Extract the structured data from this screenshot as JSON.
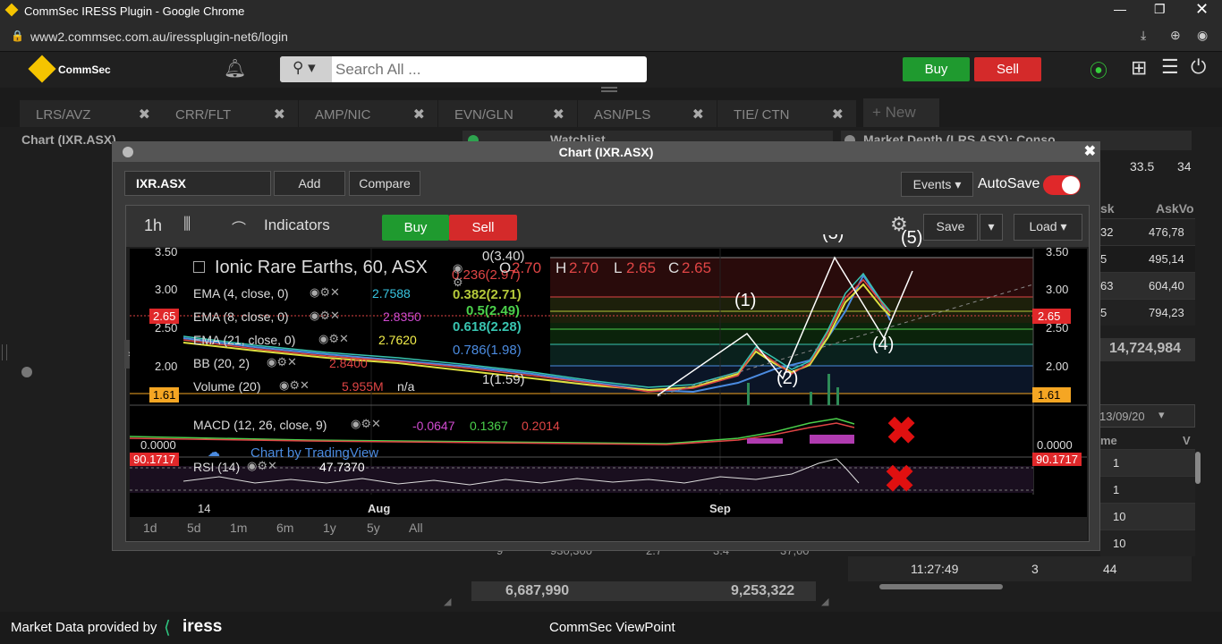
{
  "window": {
    "title": "CommSec IRESS Plugin - Google Chrome",
    "url": "www2.commsec.com.au/iressplugin-net6/login"
  },
  "app": {
    "logo": "CommSec",
    "search_placeholder": "Search All ...",
    "buy": "Buy",
    "sell": "Sell"
  },
  "tabs": [
    {
      "label": "LRS/AVZ"
    },
    {
      "label": "CRR/FLT"
    },
    {
      "label": "AMP/NIC"
    },
    {
      "label": "EVN/GLN"
    },
    {
      "label": "ASN/PLS"
    },
    {
      "label": "TIE/ CTN"
    }
  ],
  "new_tab": "+ New",
  "panels": {
    "left": "Chart (IXR.ASX)",
    "watchlist": "Watchlist",
    "depth": "Market Depth (LRS.ASX): Conso"
  },
  "depth": {
    "top_vals": [
      "33.5",
      "34"
    ],
    "header_k": "sk",
    "header_askv": "AskVo",
    "rows": [
      {
        "a": "32",
        "b": "476,78"
      },
      {
        "a": "5",
        "b": "495,14"
      },
      {
        "a": "63",
        "b": "604,40"
      },
      {
        "a": "5",
        "b": "794,23"
      }
    ],
    "total": "14,724,984",
    "date": "13/09/20",
    "col_me": "me",
    "col_v": "V",
    "trade_rows": [
      "1",
      "1",
      "10",
      "10"
    ],
    "last_time": "11:27:49",
    "last_a": "3",
    "last_b": "44"
  },
  "watchlist_bottom": {
    "row": [
      "9",
      "930,300",
      "2.7",
      "3.4",
      "37,00"
    ],
    "totals": [
      "6,687,990",
      "9,253,322"
    ]
  },
  "modal": {
    "title": "Chart (IXR.ASX)",
    "symbol": "IXR.ASX",
    "add": "Add",
    "compare": "Compare",
    "events": "Events",
    "autosave": "AutoSave"
  },
  "chart_toolbar": {
    "interval": "1h",
    "indicators": "Indicators",
    "buy": "Buy",
    "sell": "Sell",
    "save": "Save",
    "load": "Load"
  },
  "legend": {
    "title": "Ionic Rare Earths, 60, ASX",
    "o_label": "O",
    "o": "2.70",
    "h_label": "H",
    "h": "2.70",
    "l_label": "L",
    "l": "2.65",
    "c_label": "C",
    "c": "2.65",
    "ema4": "EMA (4, close, 0)",
    "ema4_val": "2.7588",
    "ema8": "EMA (8, close, 0)",
    "ema8_val": "2.8350",
    "ema21": "EMA (21, close, 0)",
    "ema21_val": "2.7620",
    "bb": "BB (20, 2)",
    "bb_val": "2.8400",
    "vol": "Volume (20)",
    "vol_val": "5.955M",
    "vol_na": "n/a",
    "macd": "MACD (12, 26, close, 9)",
    "macd_v1": "-0.0647",
    "macd_v2": "0.1367",
    "macd_v3": "0.2014",
    "rsi": "RSI (14)",
    "rsi_val": "47.7370",
    "watermark": "Chart by TradingView"
  },
  "fib": [
    {
      "label": "0(3.40)",
      "color": "#bbbbbb"
    },
    {
      "label": "0.236(2.97)",
      "color": "#e04545"
    },
    {
      "label": "0.382(2.71)",
      "color": "#b5c93a"
    },
    {
      "label": "0.5(2.49)",
      "color": "#4bd04b"
    },
    {
      "label": "0.618(2.28)",
      "color": "#38c4b0"
    },
    {
      "label": "0.786(1.98)",
      "color": "#4b8be0"
    },
    {
      "label": "1(1.59)",
      "color": "#bbbbbb"
    }
  ],
  "waves": [
    "(1)",
    "(2)",
    "(3)",
    "(4)",
    "(5)"
  ],
  "axis": {
    "price": [
      "3.50",
      "3.00",
      "2.50",
      "2.00"
    ],
    "price_badge": "2.65",
    "fib_badge": "1.61",
    "macd_zero": "0.0000",
    "rsi_badge": "90.1717",
    "x": [
      "14",
      "Aug",
      "Sep"
    ]
  },
  "timeframes": [
    "1d",
    "5d",
    "1m",
    "6m",
    "1y",
    "5y",
    "All"
  ],
  "footer": {
    "left": "Market Data provided by",
    "brand": "iress",
    "center": "CommSec ViewPoint"
  },
  "colors": {
    "green": "#1f9a2f",
    "red": "#d42a2a",
    "accent_yellow": "#f5c400"
  }
}
